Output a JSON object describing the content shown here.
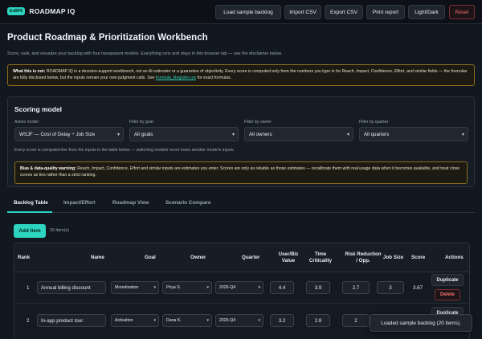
{
  "app": {
    "badge": "ExBPS",
    "name": "ROADMAP IQ"
  },
  "toolbar": {
    "load_sample": "Load sample backlog",
    "import_csv": "Import CSV",
    "export_csv": "Export CSV",
    "print_report": "Print report",
    "theme": "Light/Dark",
    "reset": "Reset"
  },
  "header": {
    "title": "Product Roadmap & Prioritization Workbench",
    "subtitle": "Score, rank, and visualize your backlog with four transparent models. Everything runs and stays in this browser tab — see the disclaimer below."
  },
  "notice": {
    "lead": "What this is not:",
    "body": " ROADMAP IQ is a decision-support workbench, not an AI estimator or a guarantee of objectivity. Every score is computed only from the numbers you type in for Reach, Impact, Confidence, Effort, and similar fields — the formulas are fully disclosed below, but the inputs remain your own judgment calls. See ",
    "link": "Formula_Register.csv",
    "tail": " for exact formulas."
  },
  "scoring": {
    "title": "Scoring model",
    "active_label": "Active model",
    "active_value": "WSJF — Cost of Delay ÷ Job Size",
    "goal_label": "Filter by goal",
    "goal_value": "All goals",
    "owner_label": "Filter by owner",
    "owner_value": "All owners",
    "quarter_label": "Filter by quarter",
    "quarter_value": "All quarters",
    "note": "Every score is computed live from the inputs in the table below — switching models never loses another model's inputs.",
    "warn_lead": "Bias & data-quality warning:",
    "warn_body": " Reach, Impact, Confidence, Effort and similar inputs are estimates you enter. Scores are only as reliable as those estimates — recalibrate them with real usage data when it becomes available, and treat close scores as ties rather than a strict ranking."
  },
  "tabs": [
    "Backlog Table",
    "Impact/Effort",
    "Roadmap View",
    "Scenario Compare"
  ],
  "backlog": {
    "add_label": "Add item",
    "count": "20 item(s)",
    "columns": {
      "rank": "Rank",
      "name": "Name",
      "goal": "Goal",
      "owner": "Owner",
      "quarter": "Quarter",
      "value": "User/Biz Value",
      "time": "Time Criticality",
      "risk": "Risk Reduction / Opp.",
      "job": "Job Size",
      "score": "Score",
      "actions": "Actions"
    },
    "rows": [
      {
        "rank": "1",
        "name": "Annual billing discount",
        "goal": "Monetization",
        "owner": "Priya S.",
        "quarter": "2026-Q4",
        "value": "4.4",
        "time": "3.9",
        "risk": "2.7",
        "job": "3",
        "score": "3.67",
        "dup": "Duplicate",
        "del": "Delete"
      },
      {
        "rank": "2",
        "name": "In-app product tour",
        "goal": "Activation",
        "owner": "Dana K.",
        "quarter": "2026-Q4",
        "value": "3.2",
        "time": "2.8",
        "risk": "2",
        "job": "",
        "score": "",
        "dup": "Duplicate",
        "del": ""
      }
    ]
  },
  "toast": "Loaded sample backlog (20 items)."
}
